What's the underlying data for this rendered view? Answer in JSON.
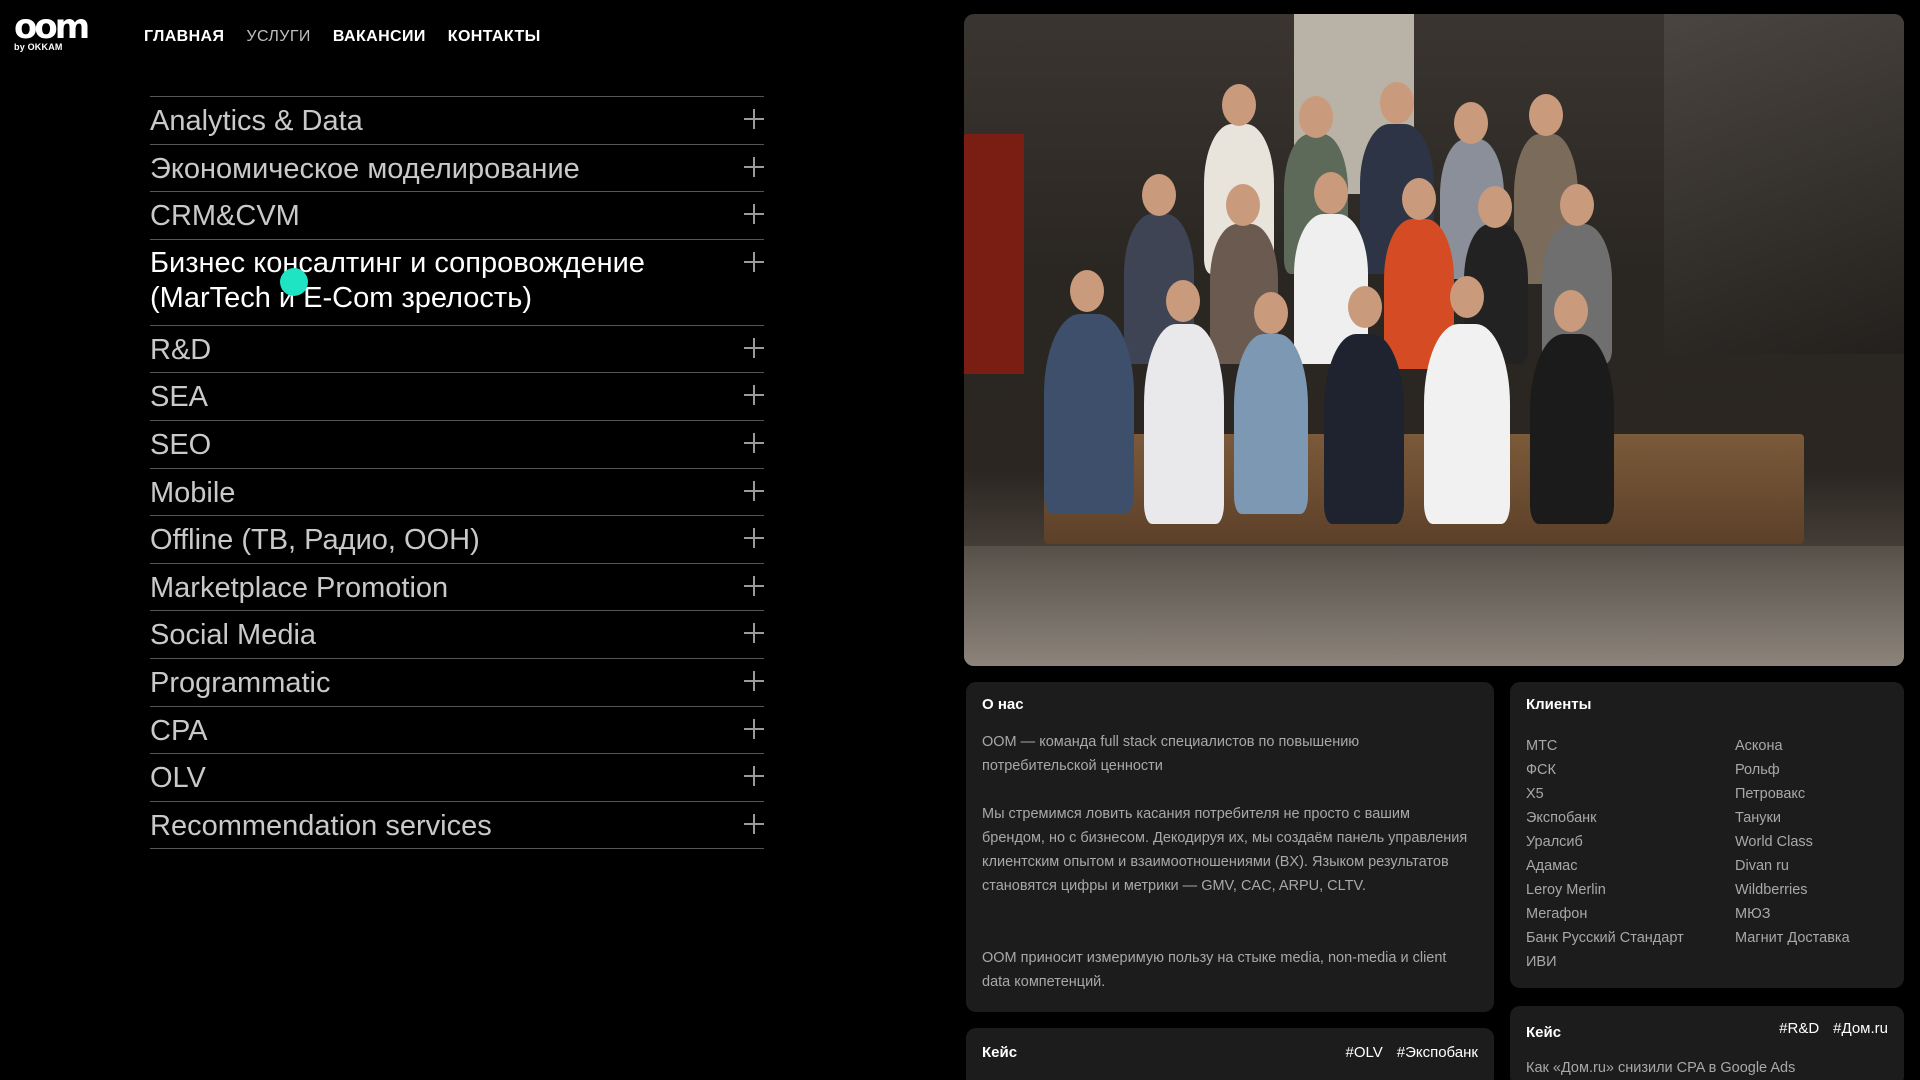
{
  "header": {
    "logo_text": "oom",
    "logo_sub": "by OKKAM",
    "nav": [
      "ГЛАВНАЯ",
      "УСЛУГИ",
      "ВАКАНСИИ",
      "КОНТАКТЫ"
    ]
  },
  "services": {
    "items": [
      {
        "label": "Analytics & Data",
        "open": false
      },
      {
        "label": "Экономическое моделирование",
        "open": false
      },
      {
        "label": "CRM&CVM",
        "open": false
      },
      {
        "label": "Бизнес консалтинг и сопровождение (MarTech и E-Com зрелость)",
        "open": true
      },
      {
        "label": "R&D",
        "open": false
      },
      {
        "label": "SEA",
        "open": false
      },
      {
        "label": "SEO",
        "open": false
      },
      {
        "label": "Mobile",
        "open": false
      },
      {
        "label": "Offline (ТВ, Радио, ООН)",
        "open": false
      },
      {
        "label": "Marketplace Promotion",
        "open": false
      },
      {
        "label": "Social Media",
        "open": false
      },
      {
        "label": "Programmatic",
        "open": false
      },
      {
        "label": "CPA",
        "open": false
      },
      {
        "label": "OLV",
        "open": false
      },
      {
        "label": "Recommendation services",
        "open": false
      }
    ]
  },
  "about": {
    "title": "О нас",
    "p1": "ООМ — команда full stack специалистов по повышению потребительской ценности",
    "p2": "Мы стремимся ловить касания потребителя не просто с вашим брендом, но с бизнесом. Декодируя их, мы создаём панель управления клиентским опытом и взаимоотношениями (BX). Языком результатов становятся цифры и метрики — GMV, CAC, ARPU, CLTV.",
    "p3": "ООМ приносит измеримую пользу на стыке media, non-media и client data компетенций."
  },
  "clients": {
    "title": "Клиенты",
    "col1": [
      "МТС",
      "ФСК",
      "Х5",
      "Экспобанк",
      "Уралсиб",
      "Адамас",
      "Leroy Merlin",
      "Мегафон",
      "Банк Русский Стандарт",
      "ИВИ"
    ],
    "col2": [
      "Аскона",
      "Рольф",
      "Петровакс",
      "Тануки",
      "World Class",
      "Divan ru",
      "Wildberries",
      "МЮЗ",
      "Магнит Доставка"
    ]
  },
  "case1": {
    "title": "Кейс",
    "tags": [
      "#OLV",
      "#Экспобанк"
    ]
  },
  "case2": {
    "title": "Кейс",
    "tags": [
      "#R&D",
      "#Дом.ru"
    ],
    "desc": "Как «Дом.ru» снизили CPA в Google Ads"
  },
  "colors": {
    "background": "#000000",
    "card": "#1c1c1c",
    "cursor": "#1ee4c4"
  }
}
